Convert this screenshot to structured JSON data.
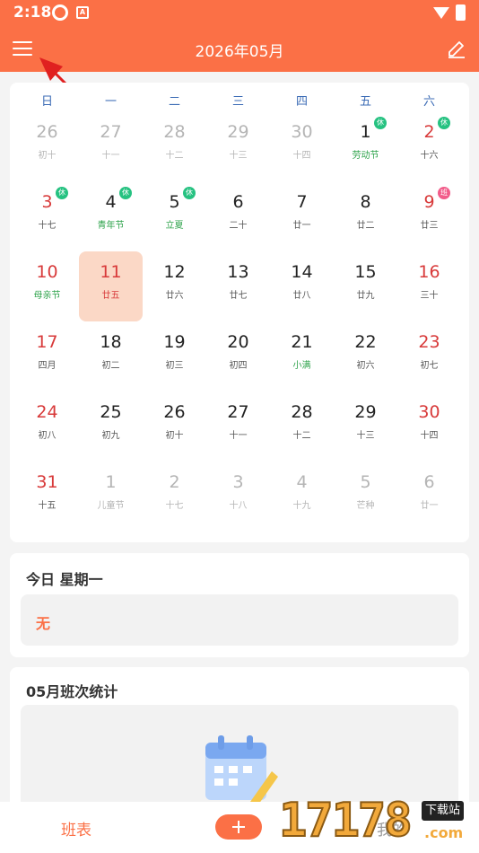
{
  "status_bar": {
    "time": "2:18",
    "app_icons": [
      "shield-icon",
      "a-square-icon"
    ],
    "system_icons": [
      "wifi-icon",
      "battery-icon"
    ]
  },
  "app_bar": {
    "title": "2026年05月",
    "menu_icon": "menu-icon",
    "edit_icon": "edit-icon"
  },
  "calendar": {
    "weekdays": [
      "日",
      "一",
      "二",
      "三",
      "四",
      "五",
      "六"
    ],
    "rows": [
      [
        {
          "day": "26",
          "lunar": "初十",
          "faded": true,
          "weekend": false
        },
        {
          "day": "27",
          "lunar": "十一",
          "faded": true
        },
        {
          "day": "28",
          "lunar": "十二",
          "faded": true
        },
        {
          "day": "29",
          "lunar": "十三",
          "faded": true
        },
        {
          "day": "30",
          "lunar": "十四",
          "faded": true
        },
        {
          "day": "1",
          "lunar": "劳动节",
          "festival": true,
          "badge": "休",
          "badge_type": "rest"
        },
        {
          "day": "2",
          "lunar": "十六",
          "weekend": true,
          "badge": "休",
          "badge_type": "rest"
        }
      ],
      [
        {
          "day": "3",
          "lunar": "十七",
          "weekend": true,
          "badge": "休",
          "badge_type": "rest"
        },
        {
          "day": "4",
          "lunar": "青年节",
          "festival": true,
          "badge": "休",
          "badge_type": "rest"
        },
        {
          "day": "5",
          "lunar": "立夏",
          "festival": true,
          "badge": "休",
          "badge_type": "rest"
        },
        {
          "day": "6",
          "lunar": "二十"
        },
        {
          "day": "7",
          "lunar": "廿一"
        },
        {
          "day": "8",
          "lunar": "廿二"
        },
        {
          "day": "9",
          "lunar": "廿三",
          "weekend": true,
          "badge": "班",
          "badge_type": "work"
        }
      ],
      [
        {
          "day": "10",
          "lunar": "母亲节",
          "weekend": true,
          "festival": true
        },
        {
          "day": "11",
          "lunar": "廿五",
          "selected": true
        },
        {
          "day": "12",
          "lunar": "廿六"
        },
        {
          "day": "13",
          "lunar": "廿七"
        },
        {
          "day": "14",
          "lunar": "廿八"
        },
        {
          "day": "15",
          "lunar": "廿九"
        },
        {
          "day": "16",
          "lunar": "三十",
          "weekend": true
        }
      ],
      [
        {
          "day": "17",
          "lunar": "四月",
          "weekend": true
        },
        {
          "day": "18",
          "lunar": "初二"
        },
        {
          "day": "19",
          "lunar": "初三"
        },
        {
          "day": "20",
          "lunar": "初四"
        },
        {
          "day": "21",
          "lunar": "小满",
          "festival": true
        },
        {
          "day": "22",
          "lunar": "初六"
        },
        {
          "day": "23",
          "lunar": "初七",
          "weekend": true
        }
      ],
      [
        {
          "day": "24",
          "lunar": "初八",
          "weekend": true
        },
        {
          "day": "25",
          "lunar": "初九"
        },
        {
          "day": "26",
          "lunar": "初十"
        },
        {
          "day": "27",
          "lunar": "十一"
        },
        {
          "day": "28",
          "lunar": "十二"
        },
        {
          "day": "29",
          "lunar": "十三"
        },
        {
          "day": "30",
          "lunar": "十四",
          "weekend": true
        }
      ],
      [
        {
          "day": "31",
          "lunar": "十五",
          "weekend": true
        },
        {
          "day": "1",
          "lunar": "儿童节",
          "faded": true
        },
        {
          "day": "2",
          "lunar": "十七",
          "faded": true
        },
        {
          "day": "3",
          "lunar": "十八",
          "faded": true
        },
        {
          "day": "4",
          "lunar": "十九",
          "faded": true
        },
        {
          "day": "5",
          "lunar": "芒种",
          "faded": true
        },
        {
          "day": "6",
          "lunar": "廿一",
          "faded": true
        }
      ]
    ]
  },
  "today": {
    "title": "今日 星期一",
    "shift": "无"
  },
  "stats": {
    "title": "05月班次统计",
    "illustration_icon": "calendar-pencil-icon"
  },
  "bottom_nav": {
    "schedule_label": "班表",
    "add_icon": "plus-icon",
    "mine_label": "我的"
  },
  "watermark": {
    "digits": "17178",
    "tag": "下载站",
    "domain": ".com"
  },
  "colors": {
    "accent": "#fb7046",
    "weekend": "#d83a3a",
    "festival": "#2ea34b",
    "rest_badge": "#26c281",
    "work_badge": "#f25c8a",
    "selected_bg": "#fbd8c6"
  }
}
